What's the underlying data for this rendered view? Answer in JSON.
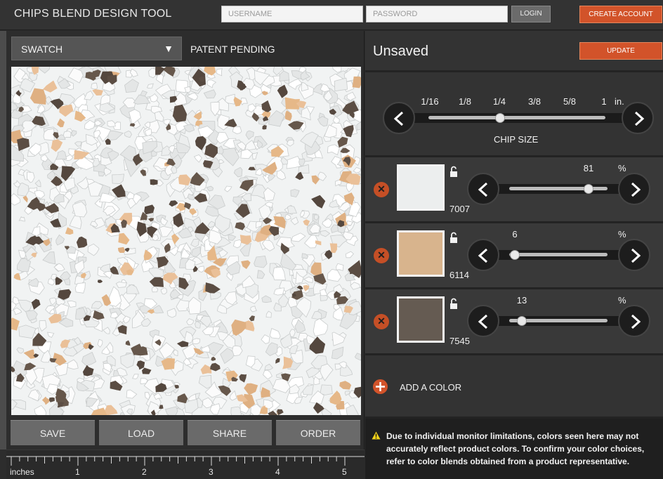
{
  "header": {
    "title": "CHIPS BLEND DESIGN TOOL",
    "username_placeholder": "USERNAME",
    "password_placeholder": "PASSWORD",
    "login_label": "LOGIN",
    "create_account_label": "CREATE ACCOUNT"
  },
  "left": {
    "view_select": "SWATCH",
    "patent": "PATENT PENDING",
    "buttons": {
      "save": "SAVE",
      "load": "LOAD",
      "share": "SHARE",
      "order": "ORDER"
    },
    "ruler": {
      "unit_label": "inches",
      "labels": [
        "1",
        "2",
        "3",
        "4",
        "5"
      ]
    }
  },
  "right": {
    "blend_name": "Unsaved",
    "update_label": "UPDATE",
    "chip_size": {
      "label": "CHIP SIZE",
      "ticks": [
        "1/16",
        "1/8",
        "1/4",
        "3/8",
        "5/8",
        "1"
      ],
      "unit": "in.",
      "selected": "1/4"
    },
    "colors": [
      {
        "code": "7007",
        "percent": "81",
        "percent_sign": "%",
        "hex": "#eceeee",
        "fraction": 0.81
      },
      {
        "code": "6114",
        "percent": "6",
        "percent_sign": "%",
        "hex": "#d8b48d",
        "fraction": 0.06
      },
      {
        "code": "7545",
        "percent": "13",
        "percent_sign": "%",
        "hex": "#655b52",
        "fraction": 0.13
      }
    ],
    "add_color_label": "ADD A COLOR",
    "notice": "Due to individual monitor limitations, colors seen here may not accurately reflect product colors. To confirm your color choices, refer to color blends obtained from a product representative."
  },
  "theme": {
    "accent": "#d2532a",
    "chip_white": "#eceeee",
    "chip_tan": "#e3b686",
    "chip_brown": "#5f5147"
  }
}
